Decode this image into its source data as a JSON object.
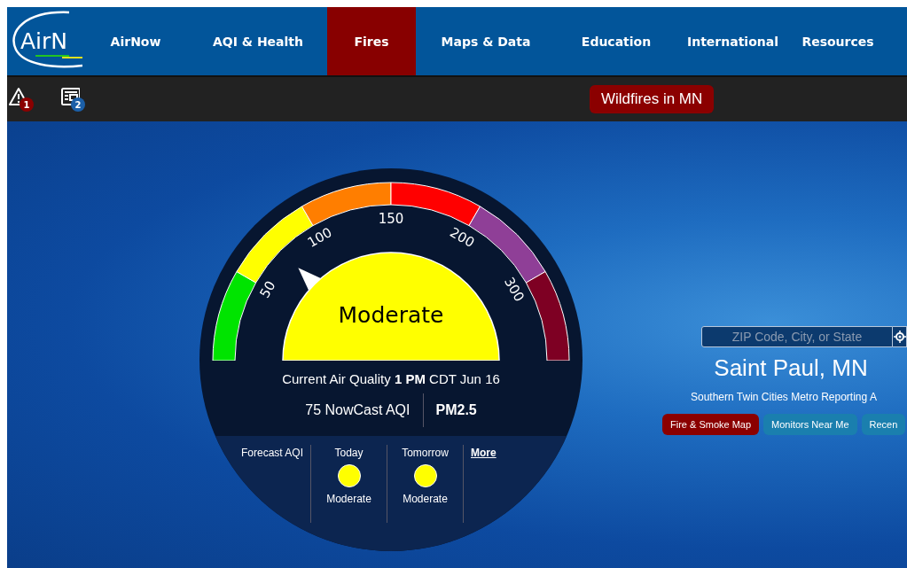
{
  "nav": {
    "logo": "AirN",
    "items": [
      {
        "label": "AirNow",
        "selected": false
      },
      {
        "label": "AQI & Health",
        "selected": false
      },
      {
        "label": "Fires",
        "selected": true
      },
      {
        "label": "Maps & Data",
        "selected": false
      },
      {
        "label": "Education",
        "selected": false
      },
      {
        "label": "International",
        "selected": false
      },
      {
        "label": "Resources",
        "selected": false
      }
    ]
  },
  "toolbar": {
    "icons": [
      {
        "kind": "alert",
        "badge": "1"
      },
      {
        "kind": "news",
        "badge": "2"
      }
    ],
    "banner": "Wildfires in MN"
  },
  "gauge": {
    "segments": [
      {
        "color": "#00e400"
      },
      {
        "color": "#ffff00"
      },
      {
        "color": "#ff7e00"
      },
      {
        "color": "#ff0000"
      },
      {
        "color": "#8f3f97"
      },
      {
        "color": "#7e0023"
      }
    ],
    "ticks": [
      "50",
      "100",
      "150",
      "200",
      "300"
    ],
    "category": {
      "label": "Moderate",
      "color": "#ffff00"
    },
    "current": "Current Air Quality **1 PM** CDT Jun 16",
    "aqi": "75 NowCast AQI",
    "pollutant": "PM2.5",
    "forecast": {
      "label": "Forecast AQI",
      "days": [
        {
          "day": "Today",
          "category": "Moderate",
          "color": "#ffff00"
        },
        {
          "day": "Tomorrow",
          "category": "Moderate",
          "color": "#ffff00"
        }
      ],
      "more": "More"
    }
  },
  "location": {
    "search": {
      "placeholder": "ZIP Code, City, or State"
    },
    "city": "Saint Paul, MN",
    "area": "Southern Twin Cities Metro Reporting A",
    "buttons": [
      {
        "label": "Fire & Smoke Map",
        "kind": "fire"
      },
      {
        "label": "Monitors Near Me",
        "kind": "info"
      },
      {
        "label": "Recen",
        "kind": "info"
      }
    ]
  }
}
